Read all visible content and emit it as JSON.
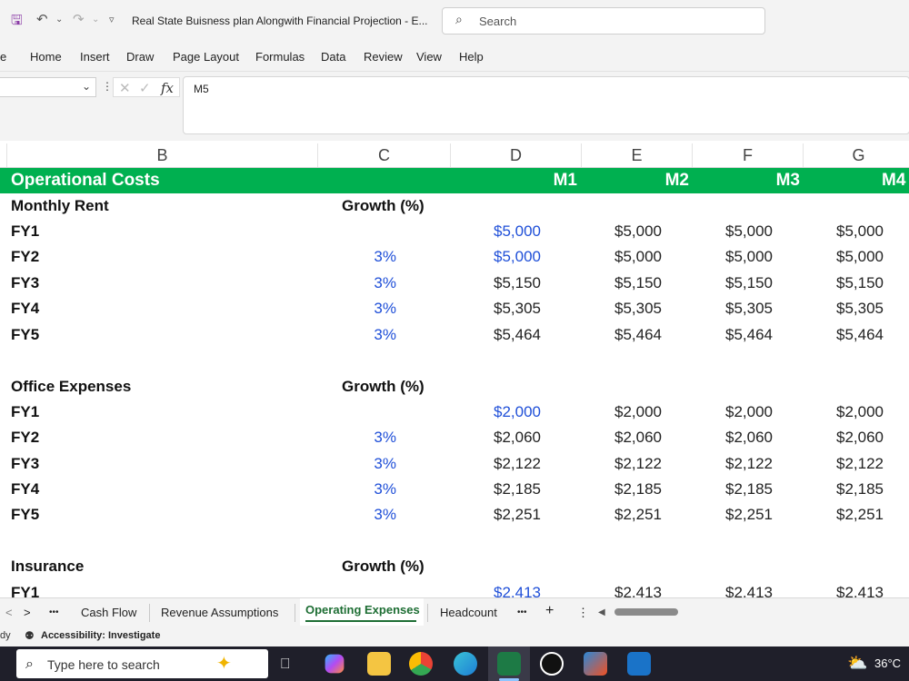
{
  "titlebar": {
    "doc_title": "Real State Buisness plan Alongwith Financial Projection  -  E...",
    "search_placeholder": "Search"
  },
  "ribbon": {
    "partial_tab": "e",
    "tabs": [
      "Home",
      "Insert",
      "Draw",
      "Page Layout",
      "Formulas",
      "Data",
      "Review",
      "View",
      "Help"
    ]
  },
  "formula_bar": {
    "fx_label": "fx",
    "content": "M5"
  },
  "columns": [
    "B",
    "C",
    "D",
    "E",
    "F",
    "G"
  ],
  "header_row": {
    "title": "Operational Costs",
    "months": [
      "M1",
      "M2",
      "M3",
      "M4"
    ]
  },
  "sections": [
    {
      "title": "Monthly Rent",
      "growth_label": "Growth (%)",
      "rows": [
        {
          "label": "FY1",
          "growth": "",
          "values": [
            "$5,000",
            "$5,000",
            "$5,000",
            "$5,000"
          ]
        },
        {
          "label": "FY2",
          "growth": "3%",
          "values": [
            "$5,000",
            "$5,000",
            "$5,000",
            "$5,000"
          ]
        },
        {
          "label": "FY3",
          "growth": "3%",
          "values": [
            "$5,150",
            "$5,150",
            "$5,150",
            "$5,150"
          ]
        },
        {
          "label": "FY4",
          "growth": "3%",
          "values": [
            "$5,305",
            "$5,305",
            "$5,305",
            "$5,305"
          ]
        },
        {
          "label": "FY5",
          "growth": "3%",
          "values": [
            "$5,464",
            "$5,464",
            "$5,464",
            "$5,464"
          ]
        }
      ]
    },
    {
      "title": "Office Expenses",
      "growth_label": "Growth (%)",
      "rows": [
        {
          "label": "FY1",
          "growth": "",
          "values": [
            "$2,000",
            "$2,000",
            "$2,000",
            "$2,000"
          ]
        },
        {
          "label": "FY2",
          "growth": "3%",
          "values": [
            "$2,060",
            "$2,060",
            "$2,060",
            "$2,060"
          ]
        },
        {
          "label": "FY3",
          "growth": "3%",
          "values": [
            "$2,122",
            "$2,122",
            "$2,122",
            "$2,122"
          ]
        },
        {
          "label": "FY4",
          "growth": "3%",
          "values": [
            "$2,185",
            "$2,185",
            "$2,185",
            "$2,185"
          ]
        },
        {
          "label": "FY5",
          "growth": "3%",
          "values": [
            "$2,251",
            "$2,251",
            "$2,251",
            "$2,251"
          ]
        }
      ]
    },
    {
      "title": "Insurance",
      "growth_label": "Growth (%)",
      "rows": [
        {
          "label": "FY1",
          "growth": "",
          "values": [
            "$2,413",
            "$2,413",
            "$2,413",
            "$2,413"
          ]
        }
      ]
    }
  ],
  "sheet_tabs": {
    "prev": "<",
    "next": ">",
    "more_left": "•••",
    "tabs": [
      "Cash Flow",
      "Revenue Assumptions",
      "Operating Expenses",
      "Headcount"
    ],
    "active": "Operating Expenses",
    "more_right": "•••",
    "add": "+",
    "options": "⋮"
  },
  "status_bar": {
    "ready_partial": "dy",
    "accessibility": "Accessibility: Investigate"
  },
  "taskbar": {
    "search_placeholder": "Type here to search",
    "weather_temp": "36°C",
    "accent_colors": {
      "excel_green": "#00b050",
      "link_blue": "#1f4fd8"
    }
  }
}
